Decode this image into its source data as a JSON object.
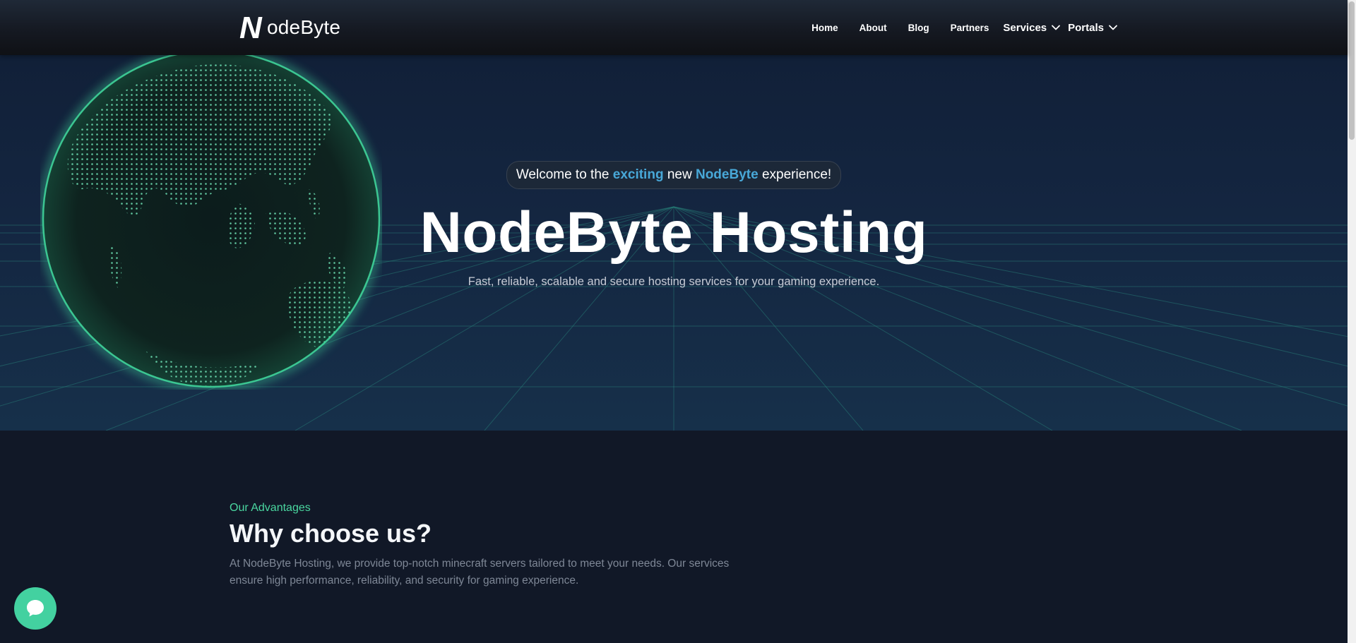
{
  "brand": {
    "name": "odeByte",
    "mark": "N"
  },
  "nav": {
    "links": [
      "Home",
      "About",
      "Blog",
      "Partners"
    ],
    "dropdowns": [
      "Services",
      "Portals"
    ]
  },
  "hero": {
    "pill": {
      "part1": "Welcome to the ",
      "accent1": "exciting",
      "part2": " new ",
      "accent2": "NodeByte",
      "part3": " experience!"
    },
    "title": "NodeByte Hosting",
    "subtitle": "Fast, reliable, scalable and secure hosting services for your gaming experience."
  },
  "advantages": {
    "eyebrow": "Our Advantages",
    "title": "Why choose us?",
    "description": "At NodeByte Hosting, we provide top-notch minecraft servers tailored to meet your needs. Our services ensure high performance, reliability, and security for gaming experience."
  },
  "colors": {
    "accent_green": "#4ad7a0",
    "accent_blue": "#48a8d8",
    "page_bg": "#111827",
    "chat_bg": "#43d1a0"
  },
  "icons": [
    "chevron-down-icon",
    "chat-bubble-icon",
    "globe-graphic"
  ]
}
